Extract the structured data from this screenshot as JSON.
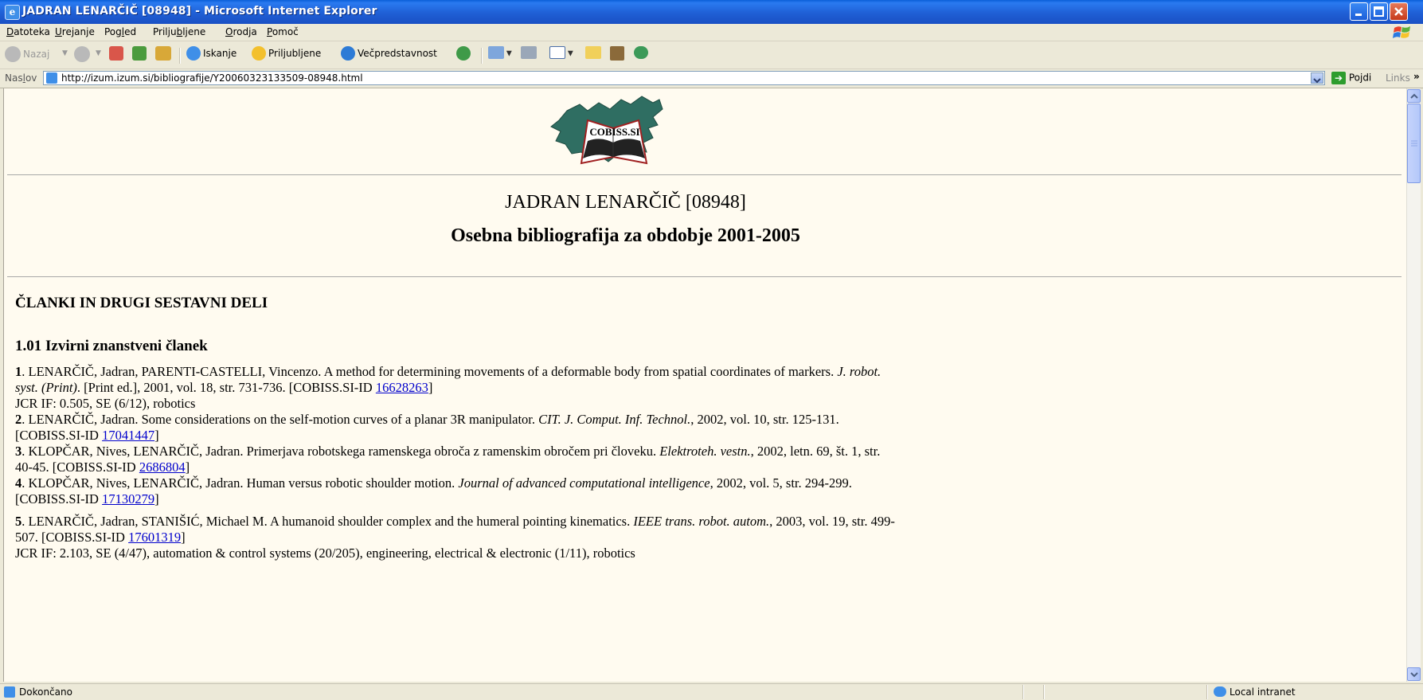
{
  "window": {
    "title": "JADRAN LENARČIČ [08948] - Microsoft Internet Explorer",
    "colors": {
      "titlebar": "#1f5fd5",
      "close": "#c6391a",
      "link": "#0000cc",
      "page_bg": "#fffbf0"
    }
  },
  "menu": {
    "items": [
      {
        "pre": "",
        "key": "D",
        "post": "atoteka"
      },
      {
        "pre": "",
        "key": "U",
        "post": "rejanje"
      },
      {
        "pre": "Pog",
        "key": "l",
        "post": "ed"
      },
      {
        "pre": "Prilju",
        "key": "b",
        "post": "ljene"
      },
      {
        "pre": "",
        "key": "O",
        "post": "rodja"
      },
      {
        "pre": "",
        "key": "P",
        "post": "omoč"
      }
    ]
  },
  "toolbar": {
    "back_label": "Nazaj",
    "search_label": "Iskanje",
    "favorites_label": "Priljubljene",
    "media_label": "Večpredstavnost",
    "icons": [
      "back-arrow-icon",
      "forward-arrow-icon",
      "stop-icon",
      "refresh-icon",
      "home-icon",
      "search-icon",
      "favorites-star-icon",
      "media-icon",
      "history-icon",
      "mail-icon",
      "print-icon",
      "edit-icon",
      "folder-icon",
      "research-icon",
      "messenger-icon"
    ]
  },
  "address": {
    "label_pre": "Nas",
    "label_key": "l",
    "label_post": "ov",
    "url": "http://izum.izum.si/bibliografije/Y20060323133509-08948.html",
    "go_label": "Pojdi",
    "links_label": "Links"
  },
  "page": {
    "logo_text": "COBISS.SI",
    "title": "JADRAN LENARČIČ [08948]",
    "subtitle": "Osebna bibliografija za obdobje 2001-2005",
    "section": "ČLANKI IN DRUGI SESTAVNI DELI",
    "subsection": "1.01 Izvirni znanstveni članek",
    "entries": [
      {
        "num": "1",
        "lines": [
          [
            {
              "t": ". LENARČIČ, Jadran, PARENTI-CASTELLI, Vincenzo. A method for determining movements of a deformable body from spatial coordinates of markers. "
            },
            {
              "t": "J. robot.",
              "i": true
            }
          ],
          [
            {
              "t": "syst. (Print)",
              "i": true
            },
            {
              "t": ". [Print ed.], 2001, vol. 18, str. 731-736. [COBISS.SI-ID "
            },
            {
              "t": "16628263",
              "a": true
            },
            {
              "t": "]"
            }
          ],
          [
            {
              "t": "JCR IF: 0.505, SE (6/12), robotics"
            }
          ]
        ]
      },
      {
        "num": "2",
        "lines": [
          [
            {
              "t": ". LENARČIČ, Jadran. Some considerations on the self-motion curves of a planar 3R manipulator. "
            },
            {
              "t": "CIT. J. Comput. Inf. Technol.",
              "i": true
            },
            {
              "t": ", 2002, vol. 10, str. 125-131."
            }
          ],
          [
            {
              "t": "[COBISS.SI-ID "
            },
            {
              "t": "17041447",
              "a": true
            },
            {
              "t": "]"
            }
          ]
        ]
      },
      {
        "num": "3",
        "lines": [
          [
            {
              "t": ". KLOPČAR, Nives, LENARČIČ, Jadran. Primerjava robotskega ramenskega obroča z ramenskim obročem pri človeku. "
            },
            {
              "t": "Elektroteh. vestn.",
              "i": true
            },
            {
              "t": ", 2002, letn. 69, št. 1, str."
            }
          ],
          [
            {
              "t": "40-45. [COBISS.SI-ID "
            },
            {
              "t": "2686804",
              "a": true
            },
            {
              "t": "]"
            }
          ]
        ]
      },
      {
        "num": "4",
        "lines": [
          [
            {
              "t": ". KLOPČAR, Nives, LENARČIČ, Jadran. Human versus robotic shoulder motion. "
            },
            {
              "t": "Journal of advanced computational intelligence",
              "i": true
            },
            {
              "t": ", 2002, vol. 5, str. 294-299."
            }
          ],
          [
            {
              "t": "[COBISS.SI-ID "
            },
            {
              "t": "17130279",
              "a": true
            },
            {
              "t": "]"
            }
          ]
        ]
      },
      {
        "num": "5",
        "lines": [
          [
            {
              "t": ". LENARČIČ, Jadran, STANIŠIĆ, Michael M. A humanoid shoulder complex and the humeral pointing kinematics. "
            },
            {
              "t": "IEEE trans. robot. autom.",
              "i": true
            },
            {
              "t": ", 2003, vol. 19, str. 499-"
            }
          ],
          [
            {
              "t": "507. [COBISS.SI-ID "
            },
            {
              "t": "17601319",
              "a": true
            },
            {
              "t": "]"
            }
          ],
          [
            {
              "t": "JCR IF: 2.103, SE (4/47), automation & control systems (20/205), engineering, electrical & electronic (1/11), robotics"
            }
          ]
        ]
      }
    ]
  },
  "status": {
    "text": "Dokončano",
    "zone": "Local intranet"
  }
}
